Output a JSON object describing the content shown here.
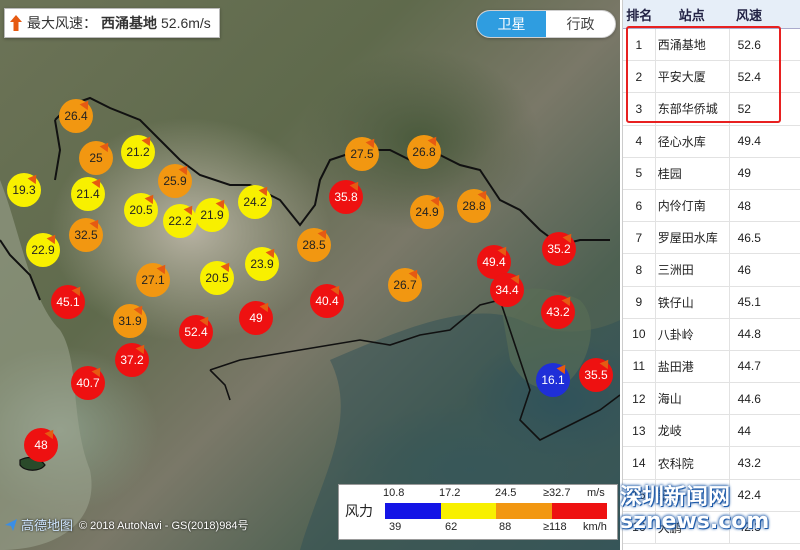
{
  "max_wind": {
    "label": "最大风速：",
    "station": "西涌基地",
    "value": "52.6m/s"
  },
  "map_toggle": {
    "satellite_label": "卫星",
    "admin_label": "行政"
  },
  "markers": [
    {
      "value": "26.4",
      "color": "#f29711"
    },
    {
      "value": "25",
      "color": "#f29711"
    },
    {
      "value": "21.2",
      "color": "#f8f000"
    },
    {
      "value": "19.3",
      "color": "#f8f000"
    },
    {
      "value": "21.4",
      "color": "#f8f000"
    },
    {
      "value": "25.9",
      "color": "#f29711"
    },
    {
      "value": "20.5",
      "color": "#f8f000"
    },
    {
      "value": "22.2",
      "color": "#f8f000"
    },
    {
      "value": "21.9",
      "color": "#f8f000"
    },
    {
      "value": "24.2",
      "color": "#f8f000"
    },
    {
      "value": "22.9",
      "color": "#f8f000"
    },
    {
      "value": "32.5",
      "color": "#f29711"
    },
    {
      "value": "27.1",
      "color": "#f29711"
    },
    {
      "value": "20.5",
      "color": "#f8f000"
    },
    {
      "value": "23.9",
      "color": "#f8f000"
    },
    {
      "value": "28.5",
      "color": "#f29711"
    },
    {
      "value": "27.5",
      "color": "#f29711"
    },
    {
      "value": "26.8",
      "color": "#f29711"
    },
    {
      "value": "35.8",
      "color": "#ee1111"
    },
    {
      "value": "24.9",
      "color": "#f29711"
    },
    {
      "value": "28.8",
      "color": "#f29711"
    },
    {
      "value": "45.1",
      "color": "#ee1111"
    },
    {
      "value": "31.9",
      "color": "#f29711"
    },
    {
      "value": "52.4",
      "color": "#ee1111"
    },
    {
      "value": "49",
      "color": "#ee1111"
    },
    {
      "value": "40.4",
      "color": "#ee1111"
    },
    {
      "value": "26.7",
      "color": "#f29711"
    },
    {
      "value": "49.4",
      "color": "#ee1111"
    },
    {
      "value": "35.2",
      "color": "#ee1111"
    },
    {
      "value": "34.4",
      "color": "#ee1111"
    },
    {
      "value": "43.2",
      "color": "#ee1111"
    },
    {
      "value": "37.2",
      "color": "#ee1111"
    },
    {
      "value": "40.7",
      "color": "#ee1111"
    },
    {
      "value": "16.1",
      "color": "#1f2fd8"
    },
    {
      "value": "35.5",
      "color": "#ee1111"
    },
    {
      "value": "48",
      "color": "#ee1111"
    }
  ],
  "legend": {
    "label": "风力",
    "ms_values": [
      "10.8",
      "17.2",
      "24.5",
      "≥32.7"
    ],
    "ms_unit": "m/s",
    "kmh_values": [
      "39",
      "62",
      "88",
      "≥118"
    ],
    "kmh_unit": "km/h",
    "colors": [
      "#1414e6",
      "#f8f000",
      "#f29711",
      "#ee1111"
    ]
  },
  "attribution": {
    "brand": "高德地图",
    "text": "© 2018 AutoNavi - GS(2018)984号"
  },
  "table": {
    "headers": [
      "排名",
      "站点",
      "风速"
    ],
    "rows": [
      [
        "1",
        "西涌基地",
        "52.6"
      ],
      [
        "2",
        "平安大厦",
        "52.4"
      ],
      [
        "3",
        "东部华侨城",
        "52"
      ],
      [
        "4",
        "径心水库",
        "49.4"
      ],
      [
        "5",
        "桂园",
        "49"
      ],
      [
        "6",
        "内伶仃南",
        "48"
      ],
      [
        "7",
        "罗屋田水库",
        "46.5"
      ],
      [
        "8",
        "三洲田",
        "46"
      ],
      [
        "9",
        "铁仔山",
        "45.1"
      ],
      [
        "10",
        "八卦岭",
        "44.8"
      ],
      [
        "11",
        "盐田港",
        "44.7"
      ],
      [
        "12",
        "海山",
        "44.6"
      ],
      [
        "13",
        "龙岐",
        "44"
      ],
      [
        "14",
        "农科院",
        "43.2"
      ],
      [
        "15",
        "翠竹",
        "42.4"
      ],
      [
        "16",
        "大鹏",
        "42.3"
      ]
    ]
  },
  "watermark": {
    "line1": "深圳新闻网",
    "line2": "sznews.com"
  }
}
